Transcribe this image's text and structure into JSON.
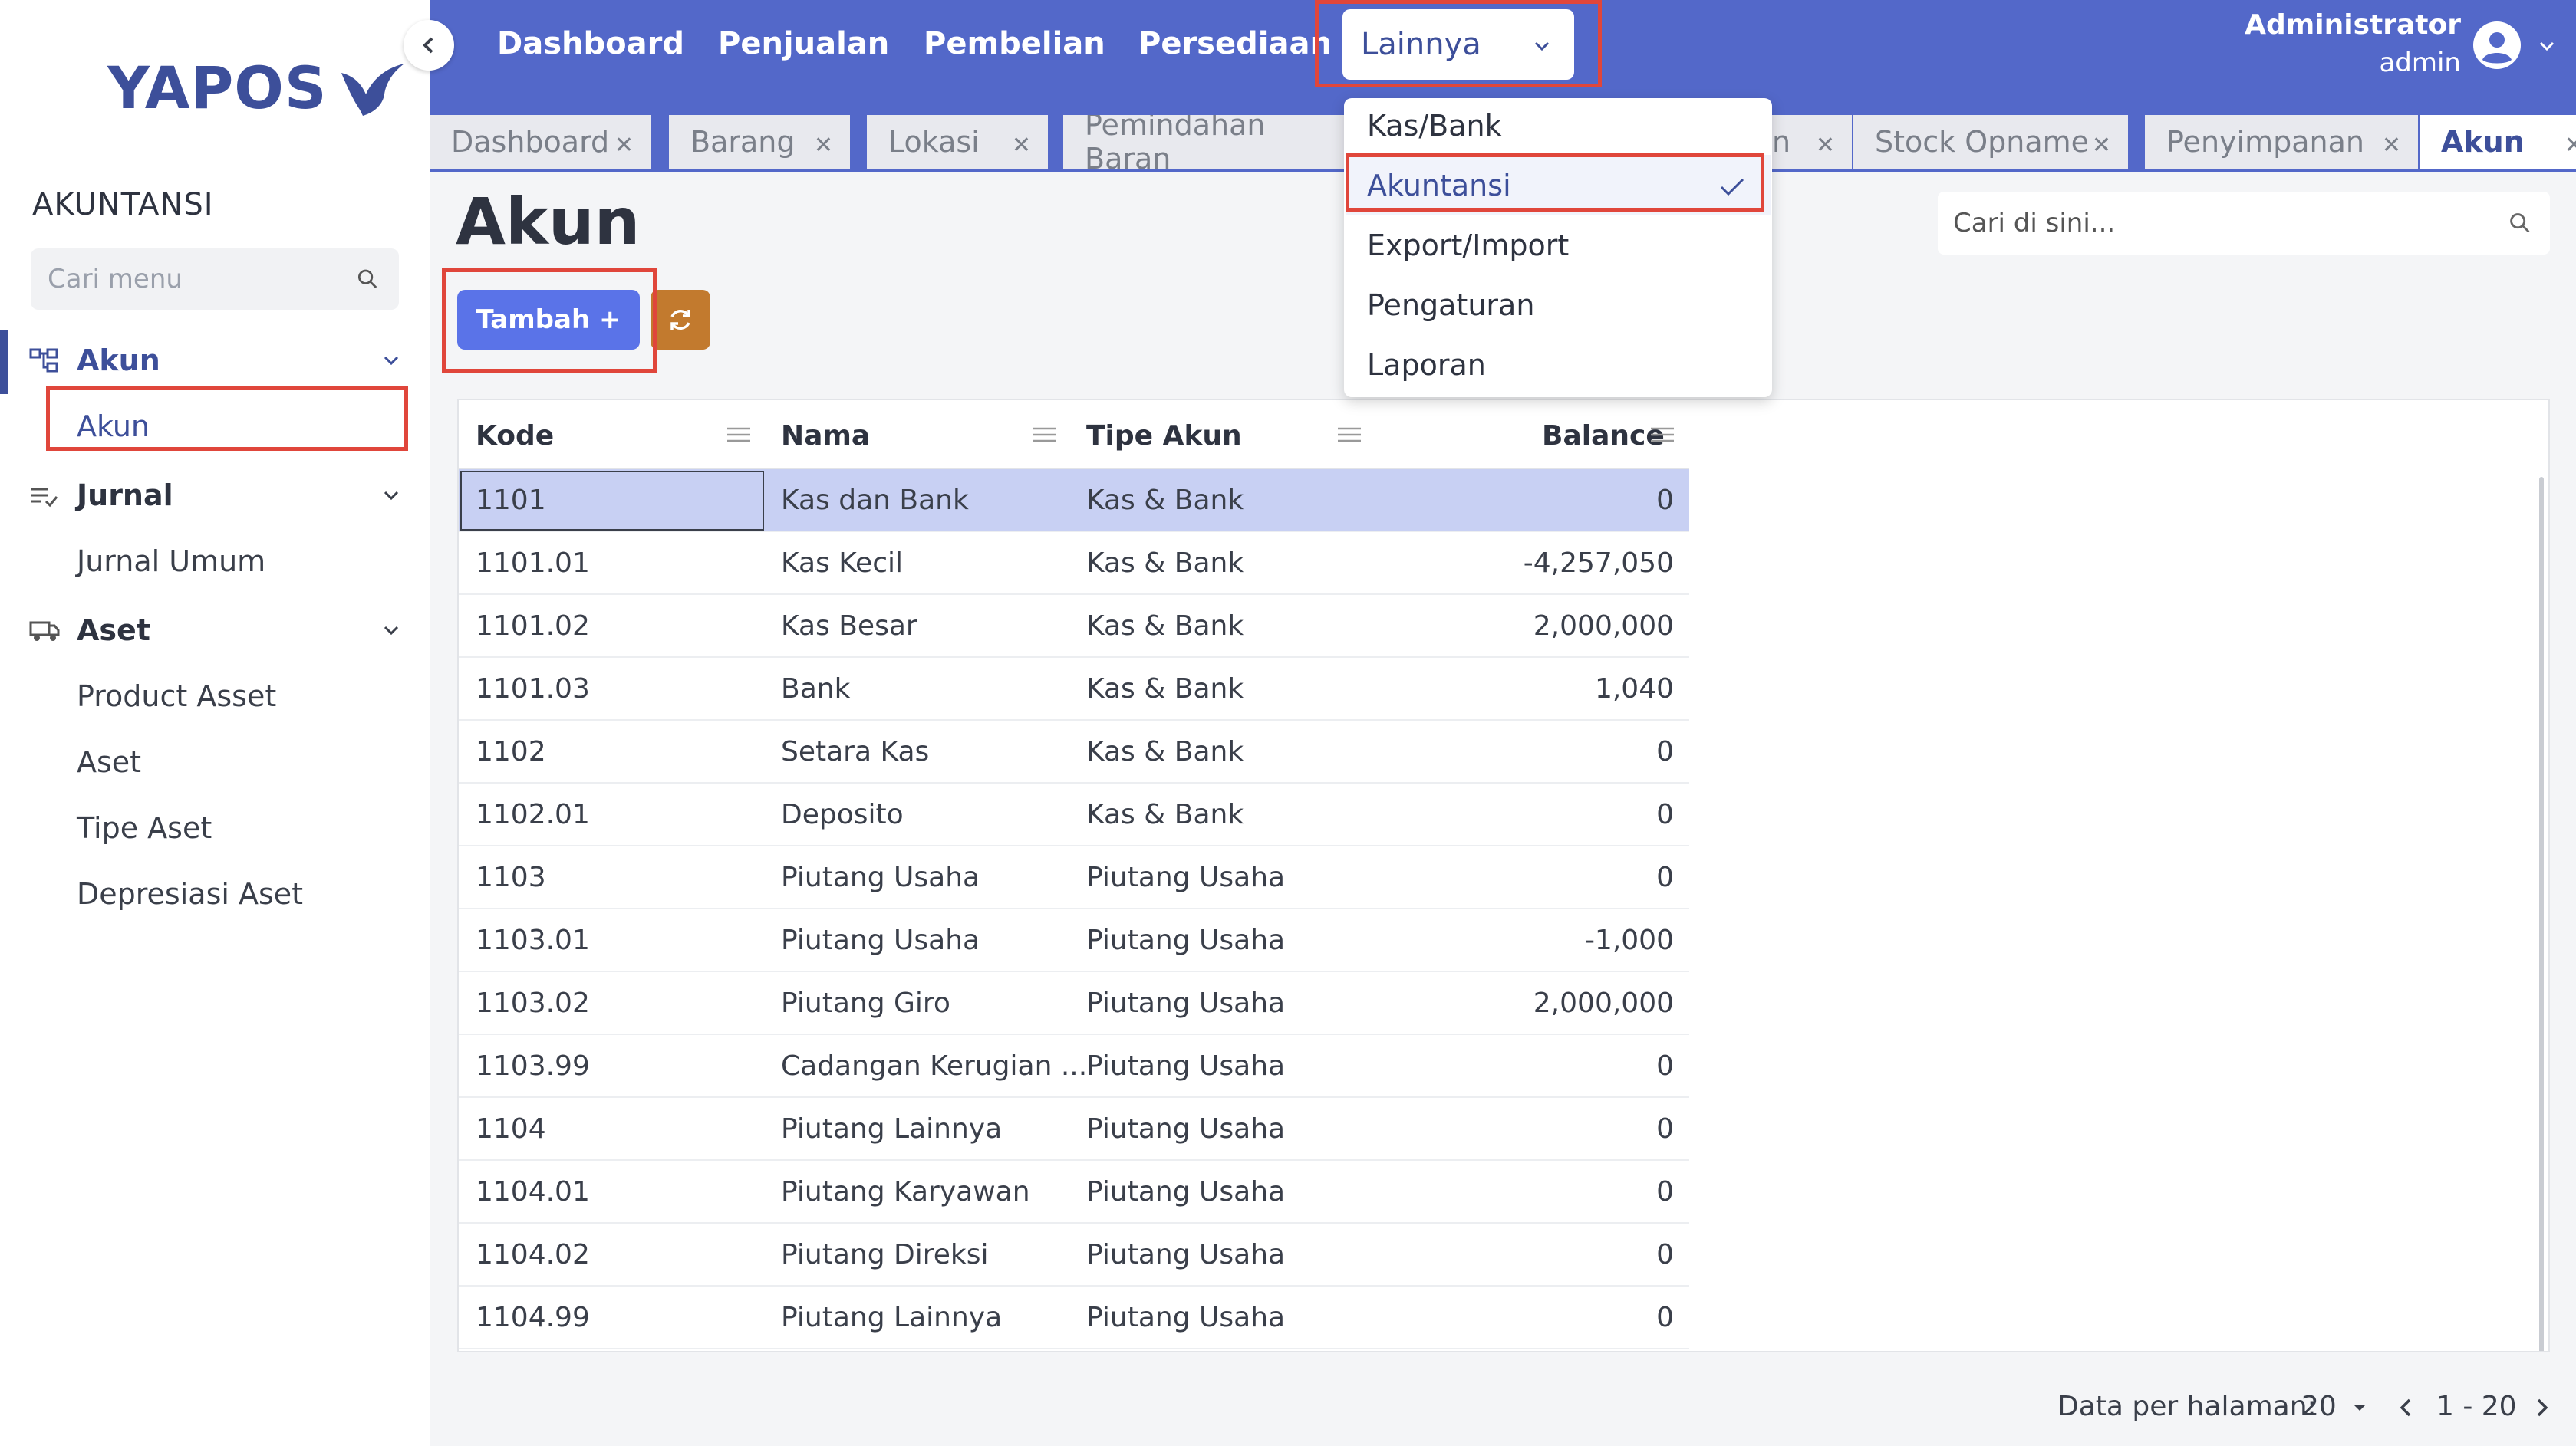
{
  "sidebar": {
    "logo_text": "YAPOS",
    "section_title": "AKUNTANSI",
    "search_placeholder": "Cari menu",
    "groups": [
      {
        "label": "Akun",
        "icon": "account-tree-icon",
        "items": [
          "Akun"
        ]
      },
      {
        "label": "Jurnal",
        "icon": "journal-list-icon",
        "items": [
          "Jurnal Umum"
        ]
      },
      {
        "label": "Aset",
        "icon": "asset-truck-icon",
        "items": [
          "Product Asset",
          "Aset",
          "Tipe Aset",
          "Depresiasi Aset"
        ]
      }
    ]
  },
  "topbar": {
    "nav": [
      "Dashboard",
      "Penjualan",
      "Pembelian",
      "Persediaan"
    ],
    "lainnya": "Lainnya",
    "user_name": "Administrator",
    "user_role": "admin"
  },
  "dropdown": {
    "items": [
      "Kas/Bank",
      "Akuntansi",
      "Export/Import",
      "Pengaturan",
      "Laporan"
    ],
    "selected": "Akuntansi"
  },
  "tabs": [
    {
      "label": "Dashboard"
    },
    {
      "label": "Barang"
    },
    {
      "label": "Lokasi"
    },
    {
      "label": "Pemindahan Baran"
    },
    {
      "label": "n"
    },
    {
      "label": "Stock Opname"
    },
    {
      "label": "Penyimpanan"
    },
    {
      "label": "Akun"
    }
  ],
  "page": {
    "title": "Akun",
    "search_placeholder": "Cari di sini...",
    "add_button": "Tambah +"
  },
  "table": {
    "headers": [
      "Kode",
      "Nama",
      "Tipe Akun",
      "Balance"
    ],
    "rows": [
      [
        "1101",
        "Kas dan Bank",
        "Kas & Bank",
        "0"
      ],
      [
        "1101.01",
        "Kas Kecil",
        "Kas & Bank",
        "-4,257,050"
      ],
      [
        "1101.02",
        "Kas Besar",
        "Kas & Bank",
        "2,000,000"
      ],
      [
        "1101.03",
        "Bank",
        "Kas & Bank",
        "1,040"
      ],
      [
        "1102",
        "Setara Kas",
        "Kas & Bank",
        "0"
      ],
      [
        "1102.01",
        "Deposito",
        "Kas & Bank",
        "0"
      ],
      [
        "1103",
        "Piutang Usaha",
        "Piutang Usaha",
        "0"
      ],
      [
        "1103.01",
        "Piutang Usaha",
        "Piutang Usaha",
        "-1,000"
      ],
      [
        "1103.02",
        "Piutang Giro",
        "Piutang Usaha",
        "2,000,000"
      ],
      [
        "1103.99",
        "Cadangan Kerugian ...",
        "Piutang Usaha",
        "0"
      ],
      [
        "1104",
        "Piutang Lainnya",
        "Piutang Usaha",
        "0"
      ],
      [
        "1104.01",
        "Piutang Karyawan",
        "Piutang Usaha",
        "0"
      ],
      [
        "1104.02",
        "Piutang Direksi",
        "Piutang Usaha",
        "0"
      ],
      [
        "1104.99",
        "Piutang Lainnya",
        "Piutang Usaha",
        "0"
      ]
    ]
  },
  "footer": {
    "per_page_label": "Data per halaman:",
    "per_page_value": "20",
    "range": "1 - 20"
  },
  "colors": {
    "primary": "#5368c9",
    "accent": "#3d4f9a",
    "add_button": "#5a73e8",
    "refresh_button": "#c27a2e",
    "highlight": "#e0463b"
  }
}
